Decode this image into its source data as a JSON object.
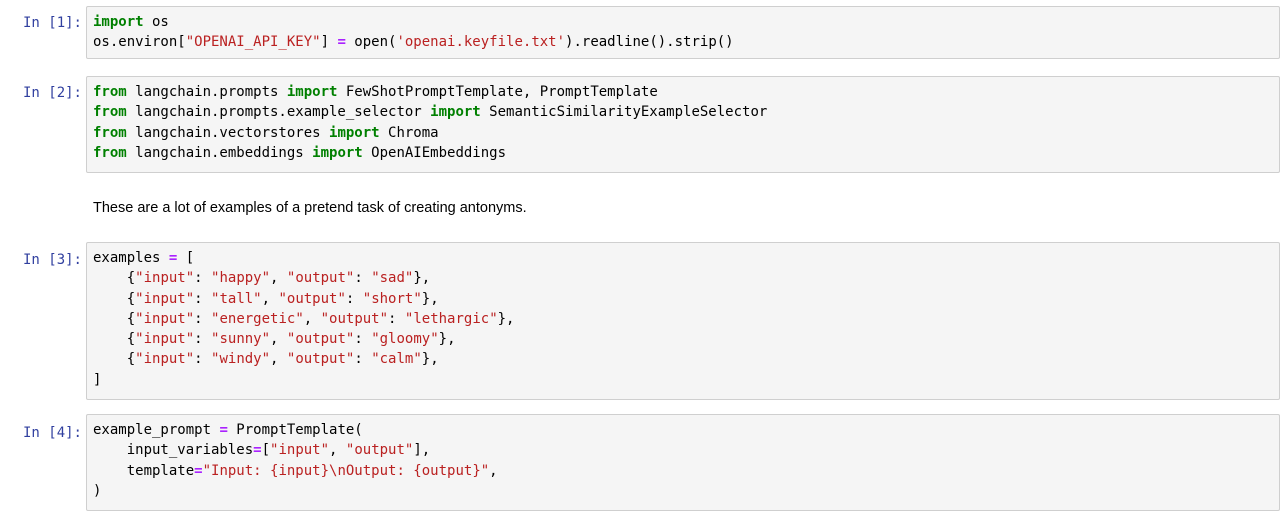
{
  "cells": [
    {
      "prompt": "In [1]:",
      "lines": [
        [
          {
            "t": "import",
            "c": "kw"
          },
          {
            "t": " os",
            "c": ""
          }
        ],
        [
          {
            "t": "os.environ[",
            "c": ""
          },
          {
            "t": "\"OPENAI_API_KEY\"",
            "c": "str"
          },
          {
            "t": "] ",
            "c": ""
          },
          {
            "t": "=",
            "c": "op"
          },
          {
            "t": " open(",
            "c": ""
          },
          {
            "t": "'openai.keyfile.txt'",
            "c": "str"
          },
          {
            "t": ").readline().strip()",
            "c": ""
          }
        ]
      ]
    },
    {
      "prompt": "In [2]:",
      "lines": [
        [
          {
            "t": "from",
            "c": "kw"
          },
          {
            "t": " langchain.prompts ",
            "c": ""
          },
          {
            "t": "import",
            "c": "kw"
          },
          {
            "t": " FewShotPromptTemplate, PromptTemplate",
            "c": ""
          }
        ],
        [
          {
            "t": "from",
            "c": "kw"
          },
          {
            "t": " langchain.prompts.example_selector ",
            "c": ""
          },
          {
            "t": "import",
            "c": "kw"
          },
          {
            "t": " SemanticSimilarityExampleSelector",
            "c": ""
          }
        ],
        [
          {
            "t": "from",
            "c": "kw"
          },
          {
            "t": " langchain.vectorstores ",
            "c": ""
          },
          {
            "t": "import",
            "c": "kw"
          },
          {
            "t": " Chroma",
            "c": ""
          }
        ],
        [
          {
            "t": "from",
            "c": "kw"
          },
          {
            "t": " langchain.embeddings ",
            "c": ""
          },
          {
            "t": "import",
            "c": "kw"
          },
          {
            "t": " OpenAIEmbeddings",
            "c": ""
          }
        ]
      ]
    },
    {
      "prompt": "In [3]:",
      "lines": [
        [
          {
            "t": "examples ",
            "c": ""
          },
          {
            "t": "=",
            "c": "op"
          },
          {
            "t": " [",
            "c": ""
          }
        ],
        [
          {
            "t": "    {",
            "c": ""
          },
          {
            "t": "\"input\"",
            "c": "str"
          },
          {
            "t": ": ",
            "c": ""
          },
          {
            "t": "\"happy\"",
            "c": "str"
          },
          {
            "t": ", ",
            "c": ""
          },
          {
            "t": "\"output\"",
            "c": "str"
          },
          {
            "t": ": ",
            "c": ""
          },
          {
            "t": "\"sad\"",
            "c": "str"
          },
          {
            "t": "},",
            "c": ""
          }
        ],
        [
          {
            "t": "    {",
            "c": ""
          },
          {
            "t": "\"input\"",
            "c": "str"
          },
          {
            "t": ": ",
            "c": ""
          },
          {
            "t": "\"tall\"",
            "c": "str"
          },
          {
            "t": ", ",
            "c": ""
          },
          {
            "t": "\"output\"",
            "c": "str"
          },
          {
            "t": ": ",
            "c": ""
          },
          {
            "t": "\"short\"",
            "c": "str"
          },
          {
            "t": "},",
            "c": ""
          }
        ],
        [
          {
            "t": "    {",
            "c": ""
          },
          {
            "t": "\"input\"",
            "c": "str"
          },
          {
            "t": ": ",
            "c": ""
          },
          {
            "t": "\"energetic\"",
            "c": "str"
          },
          {
            "t": ", ",
            "c": ""
          },
          {
            "t": "\"output\"",
            "c": "str"
          },
          {
            "t": ": ",
            "c": ""
          },
          {
            "t": "\"lethargic\"",
            "c": "str"
          },
          {
            "t": "},",
            "c": ""
          }
        ],
        [
          {
            "t": "    {",
            "c": ""
          },
          {
            "t": "\"input\"",
            "c": "str"
          },
          {
            "t": ": ",
            "c": ""
          },
          {
            "t": "\"sunny\"",
            "c": "str"
          },
          {
            "t": ", ",
            "c": ""
          },
          {
            "t": "\"output\"",
            "c": "str"
          },
          {
            "t": ": ",
            "c": ""
          },
          {
            "t": "\"gloomy\"",
            "c": "str"
          },
          {
            "t": "},",
            "c": ""
          }
        ],
        [
          {
            "t": "    {",
            "c": ""
          },
          {
            "t": "\"input\"",
            "c": "str"
          },
          {
            "t": ": ",
            "c": ""
          },
          {
            "t": "\"windy\"",
            "c": "str"
          },
          {
            "t": ", ",
            "c": ""
          },
          {
            "t": "\"output\"",
            "c": "str"
          },
          {
            "t": ": ",
            "c": ""
          },
          {
            "t": "\"calm\"",
            "c": "str"
          },
          {
            "t": "},",
            "c": ""
          }
        ],
        [
          {
            "t": "]",
            "c": ""
          }
        ]
      ]
    },
    {
      "prompt": "In [4]:",
      "lines": [
        [
          {
            "t": "example_prompt ",
            "c": ""
          },
          {
            "t": "=",
            "c": "op"
          },
          {
            "t": " PromptTemplate(",
            "c": ""
          }
        ],
        [
          {
            "t": "    input_variables",
            "c": ""
          },
          {
            "t": "=",
            "c": "op"
          },
          {
            "t": "[",
            "c": ""
          },
          {
            "t": "\"input\"",
            "c": "str"
          },
          {
            "t": ", ",
            "c": ""
          },
          {
            "t": "\"output\"",
            "c": "str"
          },
          {
            "t": "],",
            "c": ""
          }
        ],
        [
          {
            "t": "    template",
            "c": ""
          },
          {
            "t": "=",
            "c": "op"
          },
          {
            "t": "\"Input: {input}\\nOutput: {output}\"",
            "c": "str"
          },
          {
            "t": ",",
            "c": ""
          }
        ],
        [
          {
            "t": ")",
            "c": ""
          }
        ]
      ]
    }
  ],
  "markdown": {
    "text": "These are a lot of examples of a pretend task of creating antonyms."
  },
  "colors": {
    "prompt": "#303f9f",
    "keyword": "#008000",
    "string": "#ba2121",
    "operator": "#aa22ff",
    "cell_background": "#f5f5f5",
    "cell_border": "#cfcfcf"
  }
}
